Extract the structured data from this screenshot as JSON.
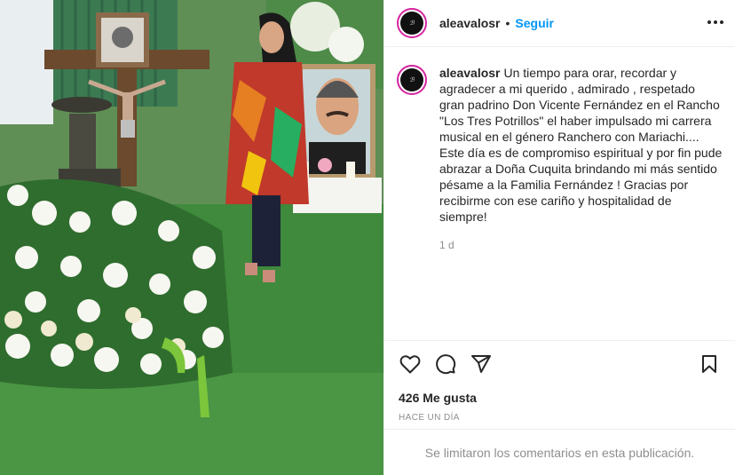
{
  "header": {
    "username": "aleavalosr",
    "separator": "•",
    "follow_label": "Seguir",
    "more_icon": "more-horizontal-icon"
  },
  "caption": {
    "username": "aleavalosr",
    "text": "Un tiempo para orar, recordar y agradecer a mi querido , admirado , respetado gran padrino Don Vicente Fernández en el Rancho \"Los Tres Potrillos\" el haber impulsado mi carrera musical en el género Ranchero con Mariachi.... Este día es de compromiso espiritual y por fin pude abrazar a Doña Cuquita brindando mi más sentido pésame a la Familia Fernández ! Gracias por recibirme con ese cariño y hospitalidad de siempre!",
    "time": "1 d"
  },
  "actions": {
    "like_icon": "heart-icon",
    "comment_icon": "comment-icon",
    "share_icon": "send-icon",
    "save_icon": "bookmark-icon"
  },
  "likes": "426 Me gusta",
  "posted_ago": "HACE UN DÍA",
  "comments_notice": "Se limitaron los comentarios en esta publicación.",
  "colors": {
    "follow": "#0095f6",
    "text": "#262626",
    "muted": "#8e8e8e",
    "grass": "#3f7d3a"
  }
}
